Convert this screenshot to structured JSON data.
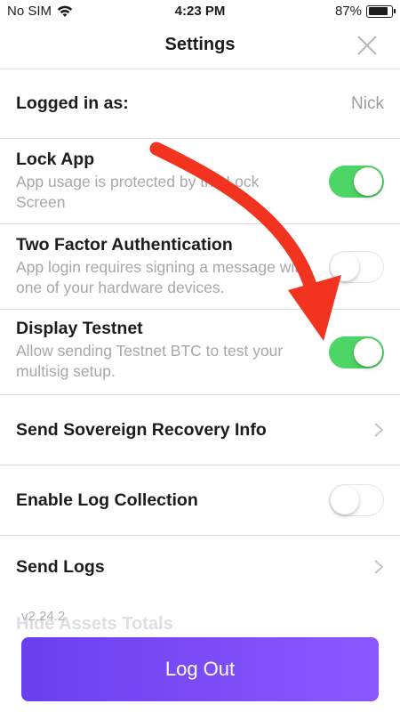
{
  "status_bar": {
    "carrier": "No SIM",
    "time": "4:23 PM",
    "battery_percent": "87%",
    "battery_level": 0.87
  },
  "nav": {
    "title": "Settings",
    "close_icon": "close-icon"
  },
  "settings": {
    "logged_in": {
      "label": "Logged in as:",
      "value": "Nick"
    },
    "lock_app": {
      "label": "Lock App",
      "description": "App usage is protected by the Lock Screen",
      "enabled": true
    },
    "two_factor": {
      "label": "Two Factor Authentication",
      "description": "App login requires signing a message with one of your hardware devices.",
      "enabled": false
    },
    "display_testnet": {
      "label": "Display Testnet",
      "description": "Allow sending Testnet BTC to test your multisig setup.",
      "enabled": true
    },
    "sovereign_recovery": {
      "label": "Send Sovereign Recovery Info"
    },
    "log_collection": {
      "label": "Enable Log Collection",
      "enabled": false
    },
    "send_logs": {
      "label": "Send Logs"
    }
  },
  "footer": {
    "version": "v2.24.2",
    "hidden_row_label": "Hide Assets Totals",
    "logout_label": "Log Out"
  },
  "colors": {
    "toggle_on": "#4cd464",
    "button_start": "#6a3fee",
    "button_end": "#8b58ff",
    "annotation_arrow": "#f2331f"
  }
}
